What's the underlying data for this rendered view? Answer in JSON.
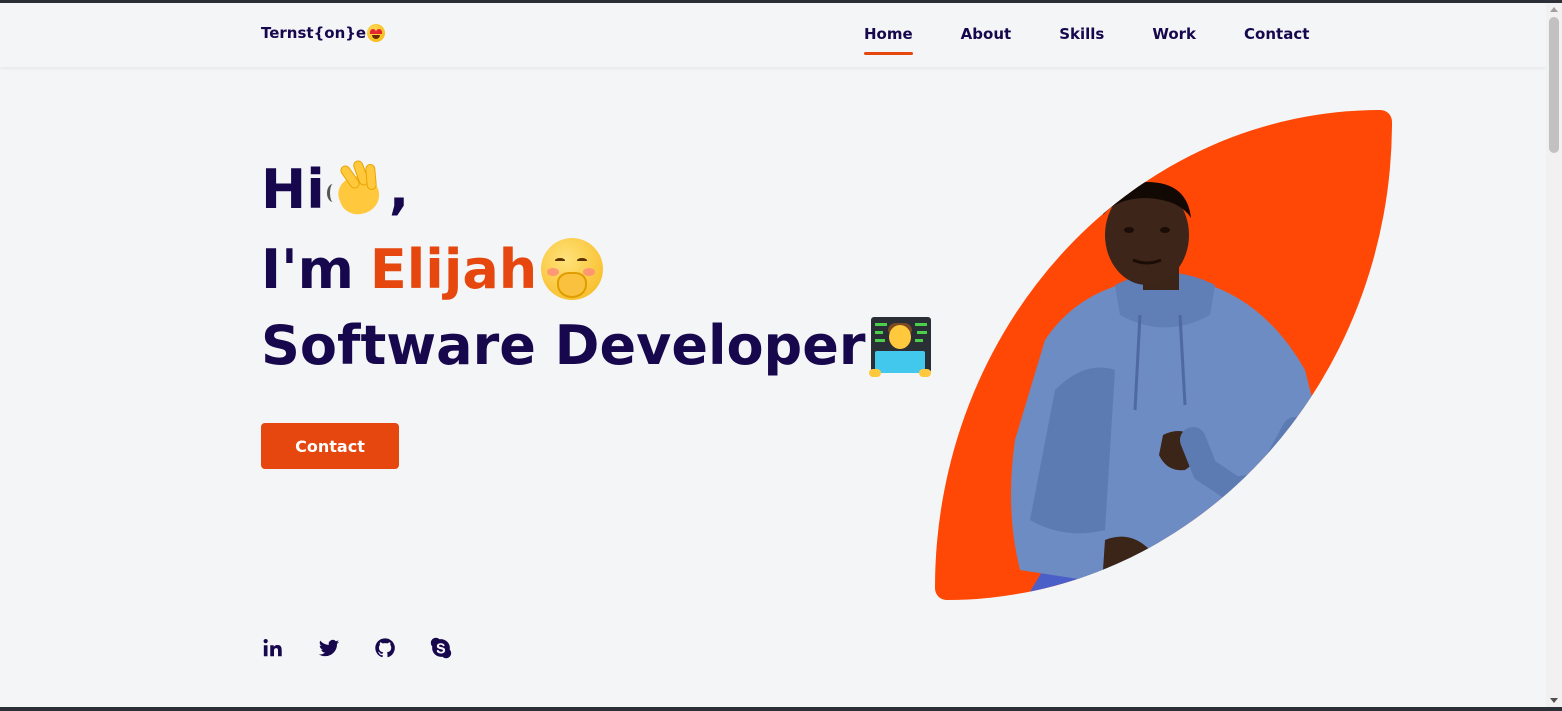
{
  "header": {
    "logo_text": "Ternst{on}e",
    "logo_emoji": "heart-eyes-emoji",
    "nav": [
      {
        "label": "Home",
        "active": true
      },
      {
        "label": "About",
        "active": false
      },
      {
        "label": "Skills",
        "active": false
      },
      {
        "label": "Work",
        "active": false
      },
      {
        "label": "Contact",
        "active": false
      }
    ]
  },
  "hero": {
    "line1": "Hi",
    "line1_suffix": ",",
    "line1_emoji": "waving-hand-emoji",
    "line2_prefix": "I'm",
    "line2_name": "Elijah",
    "line2_emoji": "hand-over-mouth-emoji",
    "line3": "Software Developer",
    "line3_emoji": "technologist-emoji",
    "button_label": "Contact",
    "image": "profile-photo"
  },
  "socials": [
    "linkedin-icon",
    "twitter-icon",
    "github-icon",
    "skype-icon"
  ],
  "colors": {
    "accent": "#e5470e",
    "blob": "#ff4805",
    "text": "#17074d",
    "background": "#f4f5f7"
  }
}
